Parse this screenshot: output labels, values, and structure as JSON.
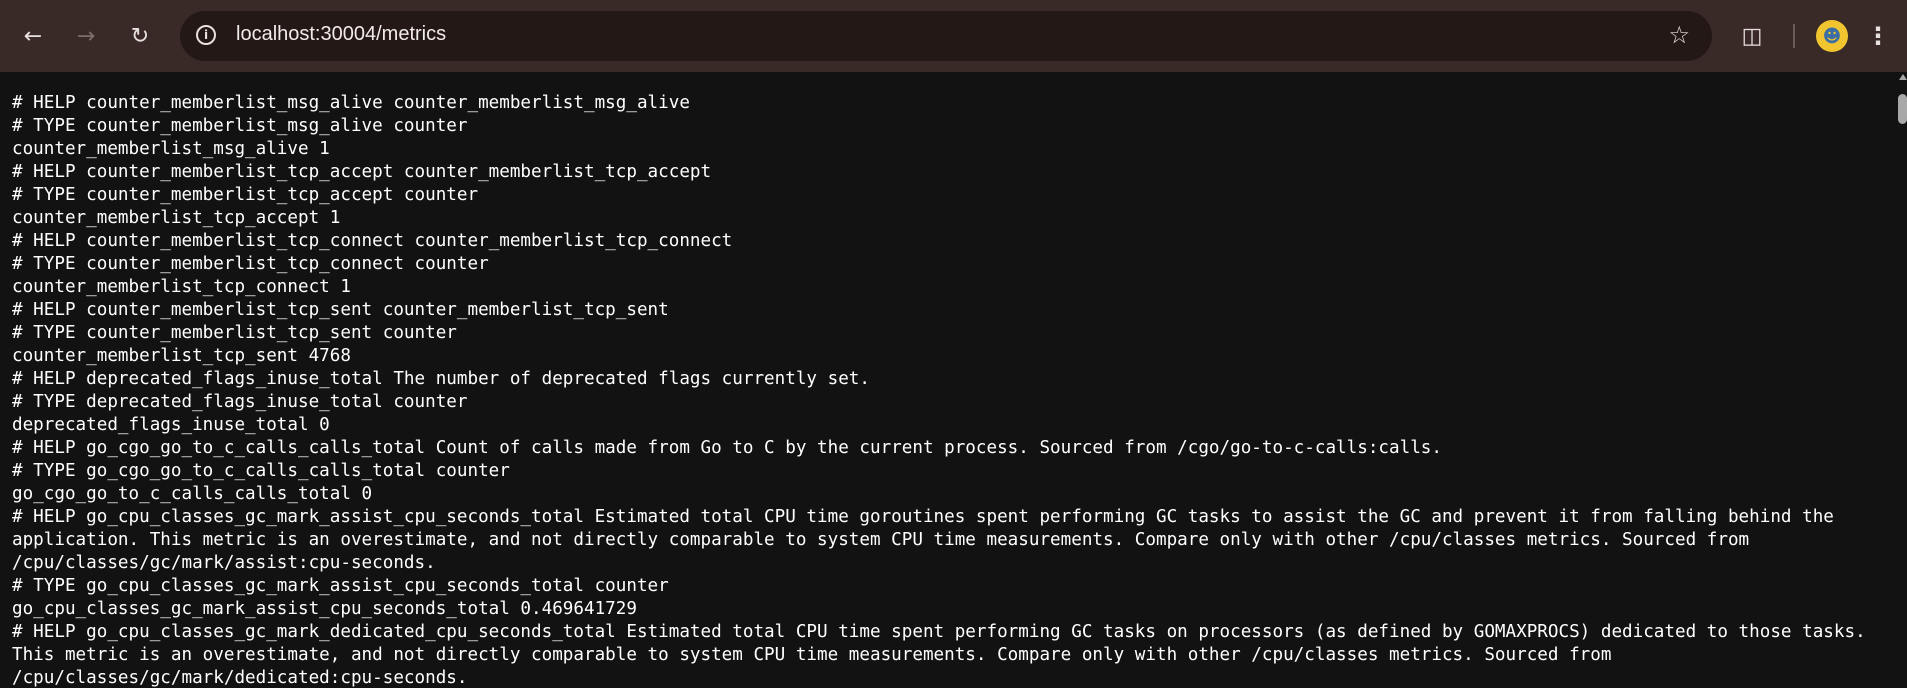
{
  "browser": {
    "url": "localhost:30004/metrics",
    "icons": {
      "back": "arrow-left",
      "forward": "arrow-right",
      "reload": "reload",
      "site_info": "info",
      "bookmark": "star",
      "extensions": "puzzle",
      "profile": "avatar",
      "menu": "kebab"
    }
  },
  "page": {
    "lines": [
      "# HELP counter_memberlist_msg_alive counter_memberlist_msg_alive",
      "# TYPE counter_memberlist_msg_alive counter",
      "counter_memberlist_msg_alive 1",
      "# HELP counter_memberlist_tcp_accept counter_memberlist_tcp_accept",
      "# TYPE counter_memberlist_tcp_accept counter",
      "counter_memberlist_tcp_accept 1",
      "# HELP counter_memberlist_tcp_connect counter_memberlist_tcp_connect",
      "# TYPE counter_memberlist_tcp_connect counter",
      "counter_memberlist_tcp_connect 1",
      "# HELP counter_memberlist_tcp_sent counter_memberlist_tcp_sent",
      "# TYPE counter_memberlist_tcp_sent counter",
      "counter_memberlist_tcp_sent 4768",
      "# HELP deprecated_flags_inuse_total The number of deprecated flags currently set.",
      "# TYPE deprecated_flags_inuse_total counter",
      "deprecated_flags_inuse_total 0",
      "# HELP go_cgo_go_to_c_calls_calls_total Count of calls made from Go to C by the current process. Sourced from /cgo/go-to-c-calls:calls.",
      "# TYPE go_cgo_go_to_c_calls_calls_total counter",
      "go_cgo_go_to_c_calls_calls_total 0",
      "# HELP go_cpu_classes_gc_mark_assist_cpu_seconds_total Estimated total CPU time goroutines spent performing GC tasks to assist the GC and prevent it from falling behind the application. This metric is an overestimate, and not directly comparable to system CPU time measurements. Compare only with other /cpu/classes metrics. Sourced from /cpu/classes/gc/mark/assist:cpu-seconds.",
      "# TYPE go_cpu_classes_gc_mark_assist_cpu_seconds_total counter",
      "go_cpu_classes_gc_mark_assist_cpu_seconds_total 0.469641729",
      "# HELP go_cpu_classes_gc_mark_dedicated_cpu_seconds_total Estimated total CPU time spent performing GC tasks on processors (as defined by GOMAXPROCS) dedicated to those tasks. This metric is an overestimate, and not directly comparable to system CPU time measurements. Compare only with other /cpu/classes metrics. Sourced from /cpu/classes/gc/mark/dedicated:cpu-seconds."
    ]
  }
}
